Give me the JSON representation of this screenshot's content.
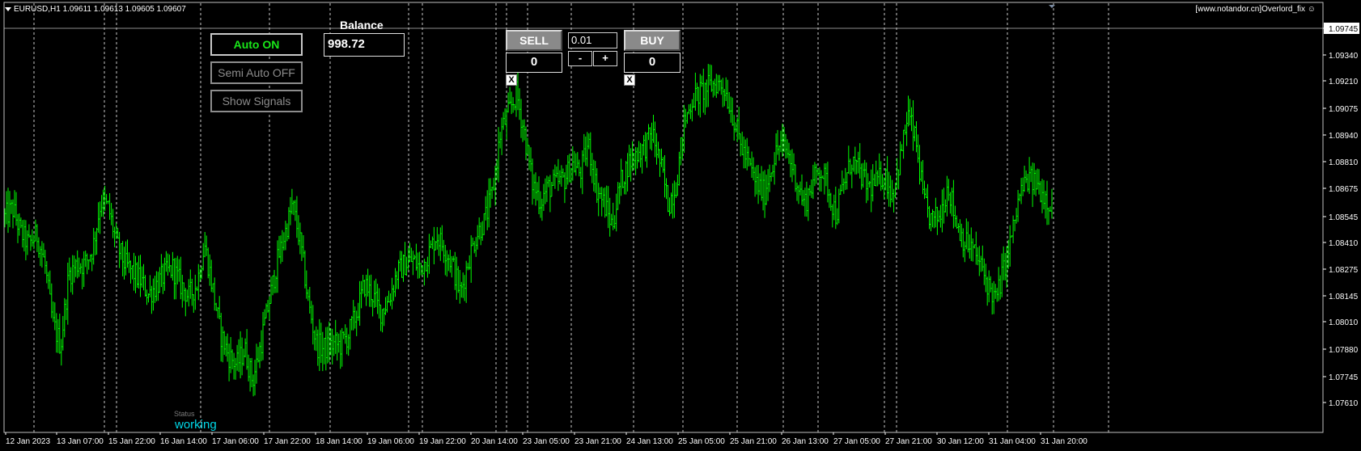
{
  "header": {
    "symbol_line": "EURUSD,H1  1.09611 1.09613 1.09605 1.09607",
    "watermark": "[www.notandor.cn]Overlord_fix",
    "smiley_icon": "smiley-icon"
  },
  "left_panel": {
    "auto_label": "Auto ON",
    "semi_label": "Semi Auto OFF",
    "signals_label": "Show Signals",
    "auto_color": "#19e619"
  },
  "balance": {
    "title": "Balance",
    "value": "998.72"
  },
  "trade_panel": {
    "sell_label": "SELL",
    "buy_label": "BUY",
    "lot_value": "0.01",
    "minus_label": "-",
    "plus_label": "+",
    "sell_count": "0",
    "buy_count": "0",
    "close_sell_label": "X",
    "close_buy_label": "X"
  },
  "status": {
    "label": "Status",
    "value": "working"
  },
  "colors": {
    "candle": "#00ff00",
    "background": "#000000",
    "grid": "#c8c8c8"
  },
  "chart_data": {
    "type": "candlestick",
    "symbol": "EURUSD",
    "timeframe": "H1",
    "last_price": "1.09607",
    "y_ticks": [
      "1.09745",
      "1.09340",
      "1.09210",
      "1.09075",
      "1.08940",
      "1.08810",
      "1.08675",
      "1.08545",
      "1.08410",
      "1.08275",
      "1.08145",
      "1.08010",
      "1.07880",
      "1.07745",
      "1.07610"
    ],
    "y_tick_values": [
      1.09745,
      1.0934,
      1.0921,
      1.09075,
      1.0894,
      1.0881,
      1.08675,
      1.08545,
      1.0841,
      1.08275,
      1.08145,
      1.0801,
      1.0788,
      1.07745,
      1.0761
    ],
    "ylim": [
      1.076,
      1.09607
    ],
    "x_ticks": [
      "12 Jan 2023",
      "13 Jan 07:00",
      "15 Jan 22:00",
      "16 Jan 14:00",
      "17 Jan 06:00",
      "17 Jan 22:00",
      "18 Jan 14:00",
      "19 Jan 06:00",
      "19 Jan 22:00",
      "20 Jan 14:00",
      "23 Jan 05:00",
      "23 Jan 21:00",
      "24 Jan 13:00",
      "25 Jan 05:00",
      "25 Jan 21:00",
      "26 Jan 13:00",
      "27 Jan 05:00",
      "27 Jan 21:00",
      "30 Jan 12:00",
      "31 Jan 04:00",
      "31 Jan 20:00"
    ],
    "close_path": [
      1.0854,
      1.0858,
      1.0846,
      1.084,
      1.0845,
      1.083,
      1.08,
      1.079,
      1.0825,
      1.083,
      1.083,
      1.0838,
      1.0862,
      1.0858,
      1.084,
      1.083,
      1.0826,
      1.0822,
      1.0815,
      1.082,
      1.0825,
      1.0828,
      1.082,
      1.0814,
      1.082,
      1.084,
      1.0818,
      1.0795,
      1.0785,
      1.078,
      1.0788,
      1.0772,
      1.079,
      1.081,
      1.083,
      1.0845,
      1.086,
      1.084,
      1.081,
      1.079,
      1.0788,
      1.079,
      1.079,
      1.0795,
      1.0805,
      1.082,
      1.0815,
      1.0806,
      1.0812,
      1.0825,
      1.083,
      1.0832,
      1.0828,
      1.0835,
      1.0845,
      1.0838,
      1.083,
      1.0815,
      1.0832,
      1.0845,
      1.0852,
      1.0865,
      1.0895,
      1.0905,
      1.0915,
      1.0895,
      1.087,
      1.0862,
      1.0868,
      1.087,
      1.0872,
      1.088,
      1.0875,
      1.089,
      1.0868,
      1.086,
      1.085,
      1.087,
      1.088,
      1.0885,
      1.0888,
      1.0895,
      1.088,
      1.086,
      1.087,
      1.09,
      1.0912,
      1.0915,
      1.0918,
      1.092,
      1.0918,
      1.0905,
      1.089,
      1.088,
      1.087,
      1.0865,
      1.088,
      1.089,
      1.0885,
      1.0872,
      1.086,
      1.087,
      1.0878,
      1.0868,
      1.0855,
      1.087,
      1.0882,
      1.0875,
      1.0868,
      1.087,
      1.0875,
      1.0865,
      1.0882,
      1.0905,
      1.089,
      1.086,
      1.0852,
      1.0855,
      1.087,
      1.0852,
      1.0842,
      1.0838,
      1.083,
      1.082,
      1.0812,
      1.0828,
      1.0845,
      1.0865,
      1.0872,
      1.087,
      1.0865,
      1.086
    ]
  }
}
